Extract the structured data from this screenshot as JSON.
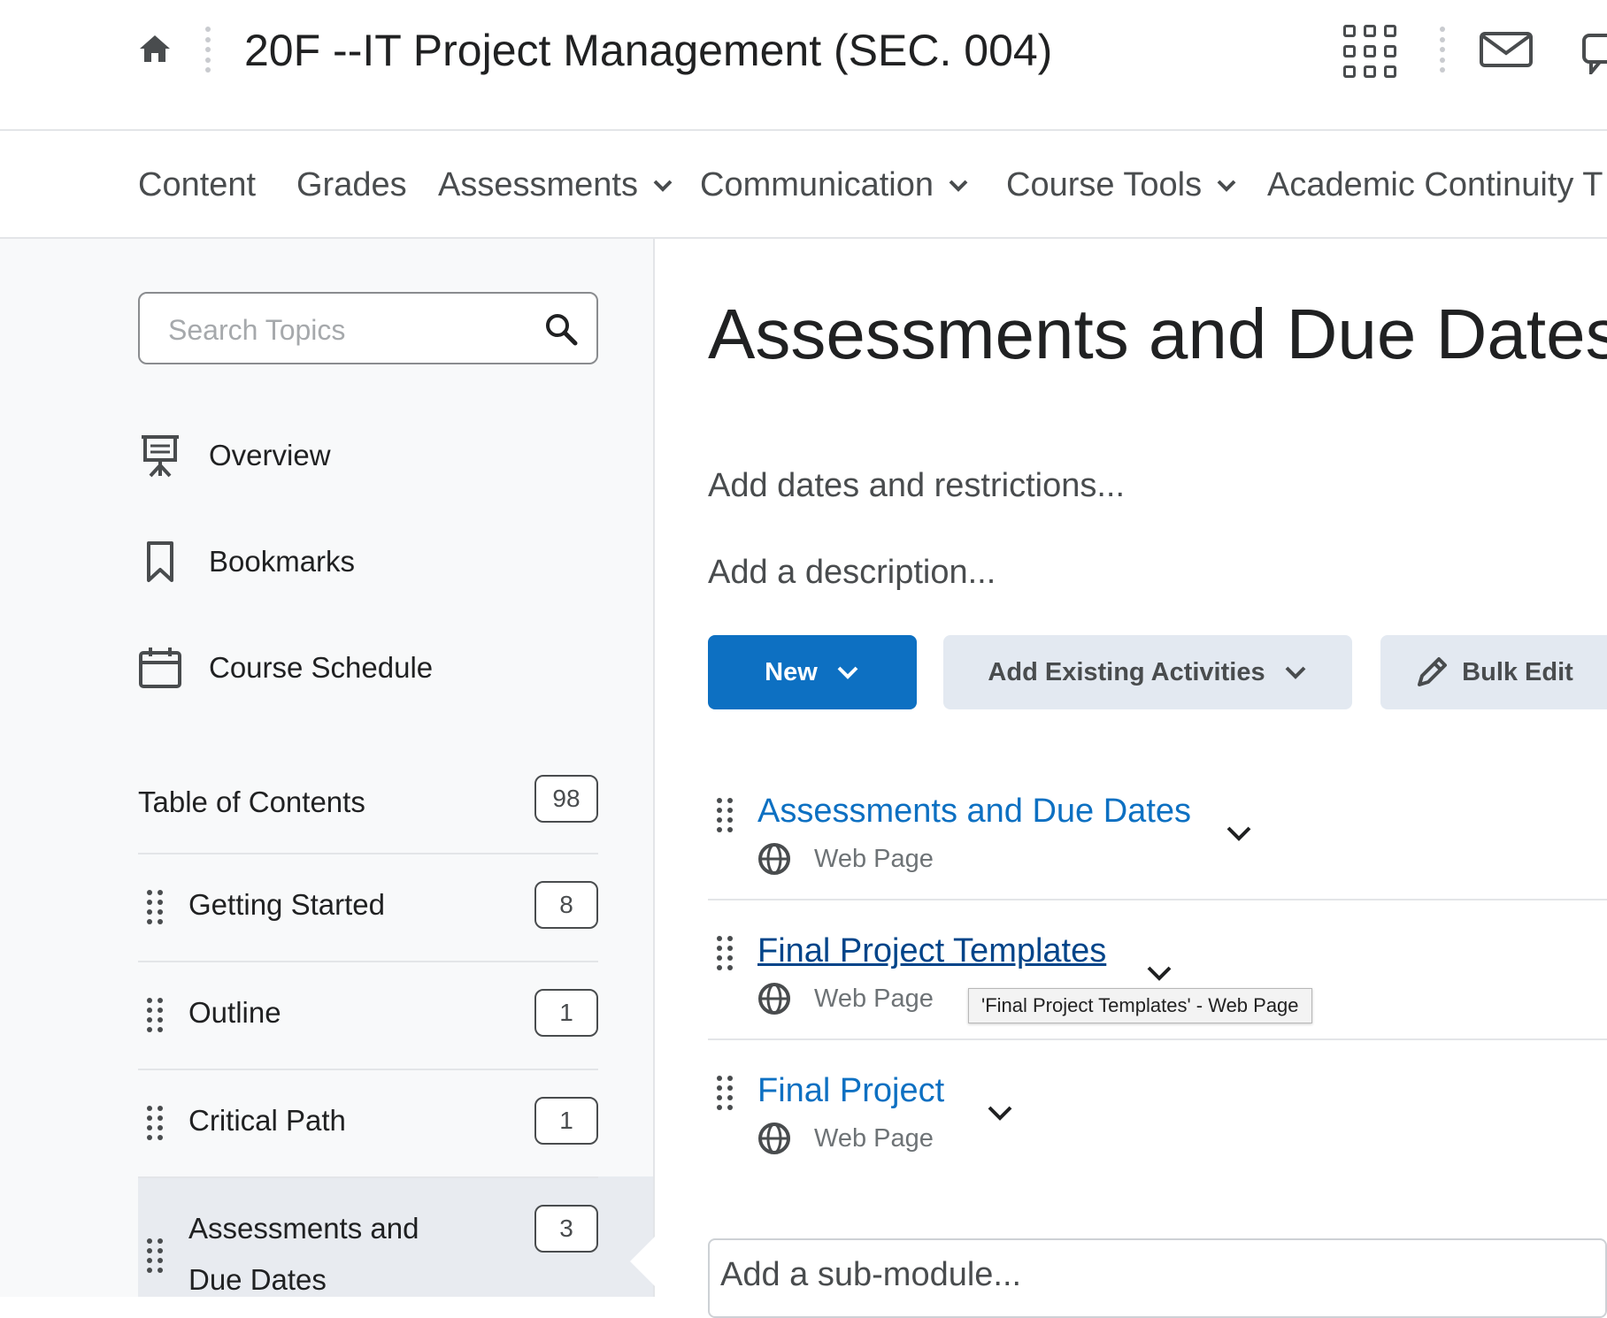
{
  "header": {
    "course_title": "20F --IT Project Management (SEC. 004)",
    "icons": [
      "home-icon",
      "waffle-icon",
      "mail-icon",
      "chat-icon"
    ]
  },
  "nav": {
    "items": [
      {
        "label": "Content",
        "has_dropdown": false
      },
      {
        "label": "Grades",
        "has_dropdown": false
      },
      {
        "label": "Assessments",
        "has_dropdown": true
      },
      {
        "label": "Communication",
        "has_dropdown": true
      },
      {
        "label": "Course Tools",
        "has_dropdown": true
      },
      {
        "label": "Academic Continuity T",
        "has_dropdown": false
      }
    ]
  },
  "sidebar": {
    "search": {
      "placeholder": "Search Topics",
      "value": ""
    },
    "links": [
      {
        "label": "Overview",
        "icon": "presentation-icon"
      },
      {
        "label": "Bookmarks",
        "icon": "bookmark-icon"
      },
      {
        "label": "Course Schedule",
        "icon": "calendar-icon"
      }
    ],
    "toc": {
      "label": "Table of Contents",
      "count": "98"
    },
    "modules": [
      {
        "label": "Getting Started",
        "count": "8"
      },
      {
        "label": "Outline",
        "count": "1"
      },
      {
        "label": "Critical Path",
        "count": "1"
      },
      {
        "label_line1": "Assessments and",
        "label_line2": "Due Dates",
        "count": "3",
        "active": true
      }
    ]
  },
  "main": {
    "heading": "Assessments and Due Dates",
    "add_dates": "Add dates and restrictions...",
    "add_description": "Add a description...",
    "buttons": {
      "new": "New",
      "add_existing": "Add Existing Activities",
      "bulk_edit": "Bulk Edit"
    },
    "items": [
      {
        "title": "Assessments and Due Dates",
        "type": "Web Page"
      },
      {
        "title": "Final Project Templates",
        "type": "Web Page",
        "hovered": true
      },
      {
        "title": "Final Project",
        "type": "Web Page"
      }
    ],
    "tooltip": "'Final Project Templates' - Web Page",
    "add_submodule": "Add a sub-module..."
  },
  "colors": {
    "accent": "#0d70c2",
    "text": "#494c4e",
    "sidebar_bg": "#f8f9fa",
    "secondary_button": "#e3e9f1"
  }
}
